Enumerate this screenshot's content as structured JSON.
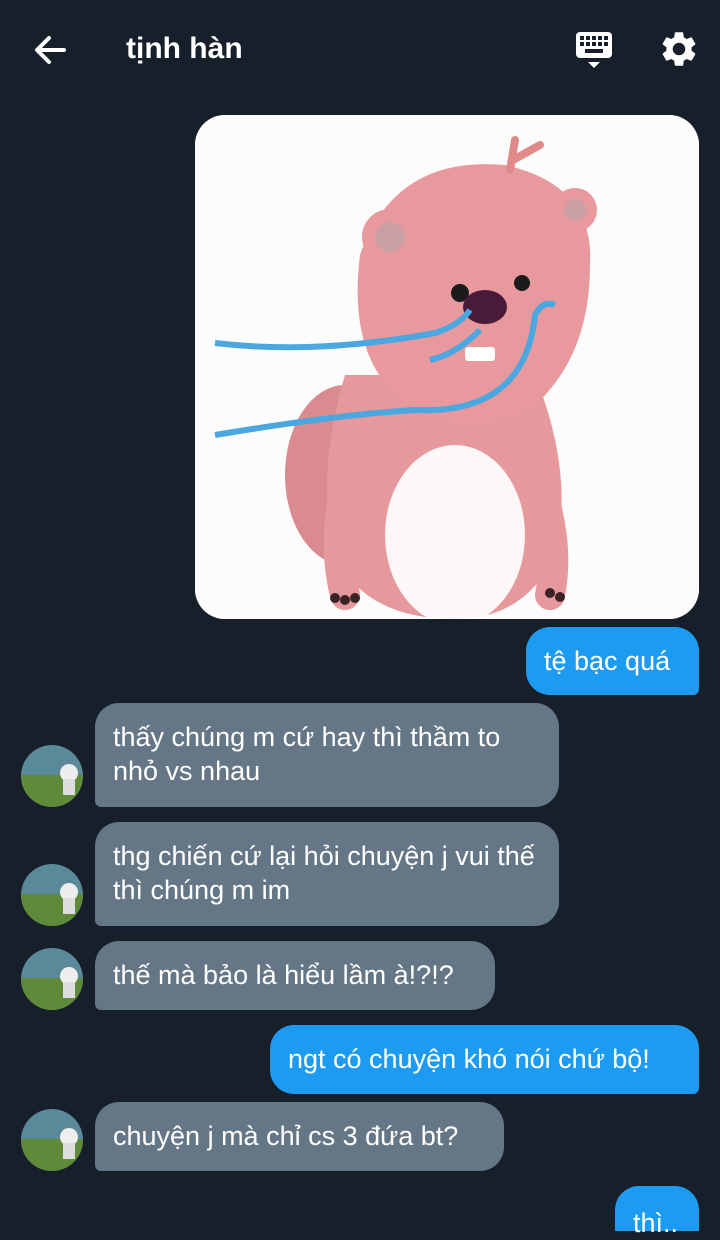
{
  "header": {
    "title": "tịnh hàn",
    "icons": [
      "back-arrow-icon",
      "keyboard-icon",
      "gear-icon"
    ]
  },
  "messages": [
    {
      "type": "image",
      "from": "me",
      "image": "pink beaver sticker"
    },
    {
      "type": "text",
      "from": "me",
      "text": "tệ bạc quá"
    },
    {
      "type": "text",
      "from": "them",
      "text": "thấy chúng m cứ hay thì thầm to nhỏ vs nhau"
    },
    {
      "type": "text",
      "from": "them",
      "text": "thg chiến cứ lại hỏi chuyện j vui thế thì chúng m im"
    },
    {
      "type": "text",
      "from": "them",
      "text": "thế mà bảo là hiểu lầm à!?!?"
    },
    {
      "type": "text",
      "from": "me",
      "text": "ngt có chuyện khó nói chứ bộ!"
    },
    {
      "type": "text",
      "from": "them",
      "text": "chuyện j mà chỉ cs 3 đứa bt?"
    },
    {
      "type": "text",
      "from": "me",
      "text": "thì.."
    }
  ],
  "colors": {
    "background": "#17202a",
    "outgoing": "#1d9bf0",
    "incoming": "#657786"
  }
}
